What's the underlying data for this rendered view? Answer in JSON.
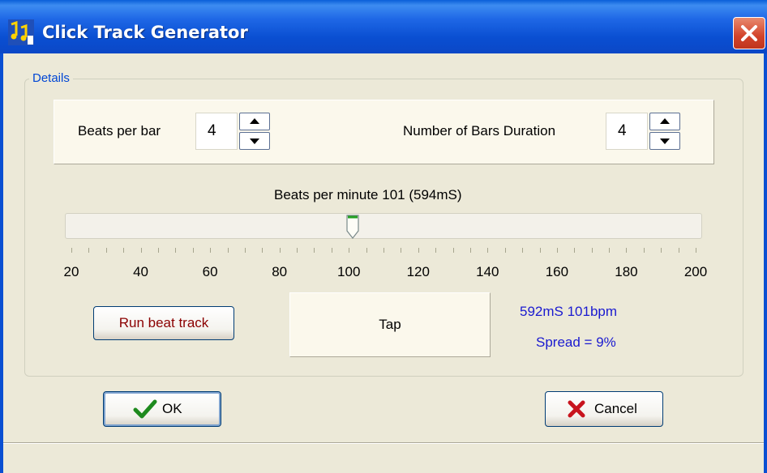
{
  "window": {
    "title": "Click Track Generator",
    "close_icon": "close-icon",
    "app_icon": "music-note-icon"
  },
  "details": {
    "legend": "Details",
    "beats_per_bar_label": "Beats per bar",
    "beats_per_bar_value": "4",
    "bars_duration_label": "Number of Bars Duration",
    "bars_duration_value": "4"
  },
  "slider": {
    "label": "Beats per minute 101  (594mS)",
    "min": 20,
    "max": 200,
    "value": 101,
    "tick_labels": [
      "20",
      "40",
      "60",
      "80",
      "100",
      "120",
      "140",
      "160",
      "180",
      "200"
    ]
  },
  "actions": {
    "run_beat_track": "Run beat track",
    "tap": "Tap",
    "tap_result": "592mS  101bpm",
    "spread": "Spread = 9%"
  },
  "footer": {
    "ok": "OK",
    "cancel": "Cancel"
  },
  "colors": {
    "title_bar": "#0a4fd2",
    "legend_text": "#0046d5",
    "stat_text": "#1a1ad0",
    "run_button_text": "#8b0000"
  }
}
